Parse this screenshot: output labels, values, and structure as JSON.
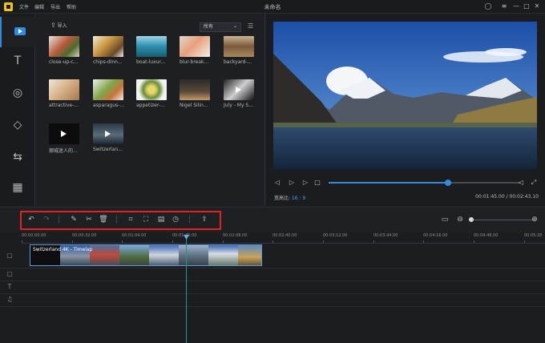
{
  "title_bar": {
    "title": "未命名",
    "menu": [
      "文件",
      "编辑",
      "导出",
      "帮助"
    ]
  },
  "rail": {
    "items": [
      "media-icon",
      "text-icon",
      "filter-icon",
      "overlay-icon",
      "transition-icon",
      "element-icon"
    ]
  },
  "library": {
    "import_label": "导入",
    "filter_value": "所有",
    "items": [
      {
        "caption": "close-up-c..."
      },
      {
        "caption": "chips-dinn..."
      },
      {
        "caption": "boat-luxur..."
      },
      {
        "caption": "blur-break..."
      },
      {
        "caption": "backyard-..."
      },
      {
        "caption": "attractive-..."
      },
      {
        "caption": "asparagus-..."
      },
      {
        "caption": "appetizer-..."
      },
      {
        "caption": "Nigel Silin..."
      },
      {
        "caption": "July - My S..."
      },
      {
        "caption": "挪威迷人的..."
      },
      {
        "caption": "Switzerlan..."
      }
    ]
  },
  "preview": {
    "ratio_label": "宽高比",
    "ratio_value": "16 : 9",
    "time_display": "00:01:45.00 / 00:02:43.10",
    "progress": 0.62
  },
  "timeline": {
    "ruler": [
      "00:00:00.00",
      "00:00:32.00",
      "00:01:04.00",
      "00:01:36.00",
      "00:02:08.00",
      "00:02:40.00",
      "00:03:12.00",
      "00:03:44.00",
      "00:04:16.00",
      "00:04:48.00",
      "00:05:20"
    ],
    "clip_label": "Switzerland 4K - Timelap"
  },
  "colors": {
    "accent": "#2f8bde",
    "highlight": "#e02424",
    "playhead": "#1c9c88"
  }
}
